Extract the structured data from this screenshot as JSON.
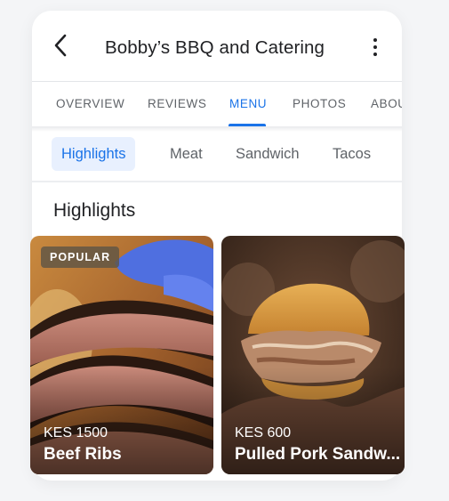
{
  "header": {
    "title": "Bobby’s BBQ and Catering",
    "back_icon": "arrow-left-icon",
    "more_icon": "more-vertical-icon"
  },
  "tabs": [
    {
      "label": "OVERVIEW",
      "active": false
    },
    {
      "label": "REVIEWS",
      "active": false
    },
    {
      "label": "MENU",
      "active": true
    },
    {
      "label": "PHOTOS",
      "active": false
    },
    {
      "label": "ABOUT",
      "active": false
    }
  ],
  "categories": [
    {
      "label": "Highlights",
      "active": true
    },
    {
      "label": "Meat",
      "active": false
    },
    {
      "label": "Sandwich",
      "active": false
    },
    {
      "label": "Tacos",
      "active": false
    }
  ],
  "section_title": "Highlights",
  "items": [
    {
      "badge": "POPULAR",
      "price": "KES 1500",
      "name": "Beef Ribs"
    },
    {
      "badge": "",
      "price": "KES 600",
      "name": "Pulled Pork Sandw..."
    }
  ],
  "colors": {
    "accent": "#1a73e8",
    "chip_bg": "#e8f0fe",
    "text": "#202124",
    "muted": "#5f6368"
  }
}
